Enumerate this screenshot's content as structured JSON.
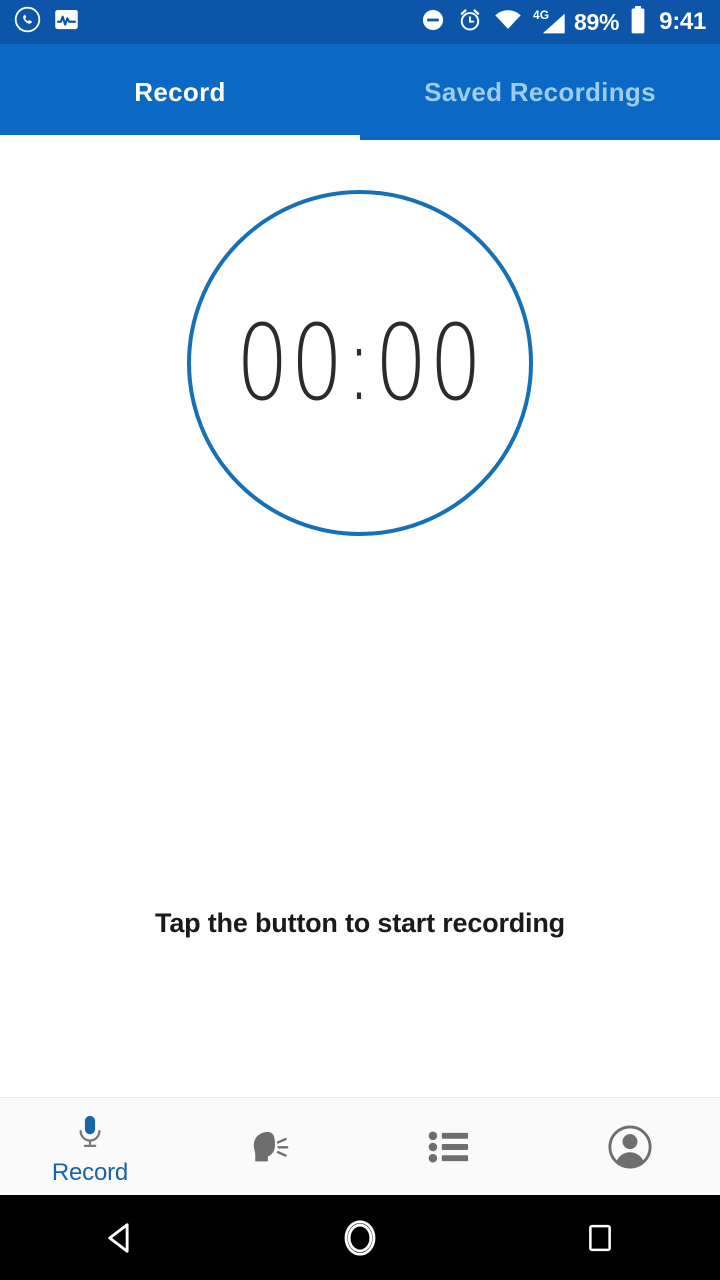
{
  "status_bar": {
    "left_icons": [
      {
        "name": "whatsapp-icon",
        "label": "WhatsApp"
      },
      {
        "name": "activity-monitor-icon",
        "label": "Activity Monitor"
      }
    ],
    "right_icons": [
      {
        "name": "do-not-disturb-icon",
        "label": "Do Not Disturb"
      },
      {
        "name": "alarm-icon",
        "label": "Alarm"
      },
      {
        "name": "wifi-icon",
        "label": "Wi-Fi"
      },
      {
        "name": "cellular-signal-icon",
        "label": "4G Signal"
      }
    ],
    "network_type": "4G",
    "battery_percent": "89%",
    "clock": "9:41",
    "background_color": "#0C55A8"
  },
  "header": {
    "background_color": "#0B68C4",
    "tabs": [
      {
        "label": "Record",
        "active": true
      },
      {
        "label": "Saved Recordings",
        "active": false
      }
    ],
    "active_indicator_color": "#FFFFFF",
    "inactive_tab_color": "#9ECBF0"
  },
  "main": {
    "timer": {
      "value": "00:00",
      "circle_border_color": "#1570B8",
      "text_color": "#2B2B2B"
    },
    "hint_text": "Tap the button to start recording",
    "record_button": {
      "name": "record-mic-button",
      "icon": "microphone-icon",
      "background_color": "#1E9DF1",
      "icon_color": "#FFFFFF"
    }
  },
  "bottom_nav": {
    "background_color": "#FAFAFA",
    "active_color": "#1565A8",
    "inactive_color": "#6E6E6E",
    "items": [
      {
        "id": "record",
        "label": "Record",
        "icon": "microphone-icon",
        "active": true
      },
      {
        "id": "speak",
        "label": "",
        "icon": "speaking-head-icon",
        "active": false
      },
      {
        "id": "list",
        "label": "",
        "icon": "list-icon",
        "active": false
      },
      {
        "id": "profile",
        "label": "",
        "icon": "person-circle-icon",
        "active": false
      }
    ]
  },
  "android_nav": {
    "background_color": "#000000",
    "buttons": [
      {
        "id": "back",
        "icon": "back-triangle-icon"
      },
      {
        "id": "home",
        "icon": "home-circle-icon"
      },
      {
        "id": "recents",
        "icon": "recents-square-icon"
      }
    ]
  }
}
